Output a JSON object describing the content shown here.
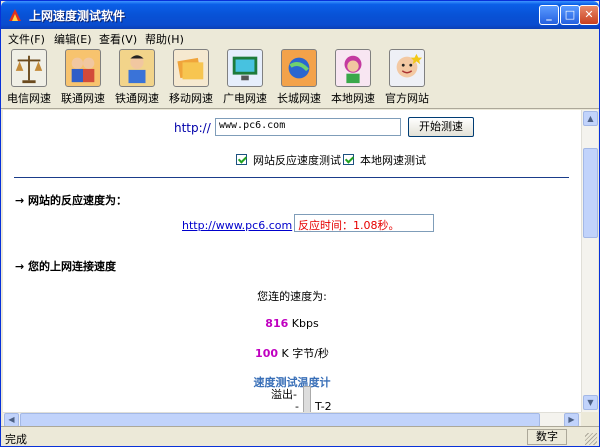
{
  "window": {
    "title": "上网速度测试软件"
  },
  "menu": [
    {
      "label": "文件(F)"
    },
    {
      "label": "编辑(E)"
    },
    {
      "label": "查看(V)"
    },
    {
      "label": "帮助(H)"
    }
  ],
  "toolbar": [
    {
      "label": "电信网速",
      "icon": "scale-icon"
    },
    {
      "label": "联通网速",
      "icon": "people-icon"
    },
    {
      "label": "铁通网速",
      "icon": "person-icon"
    },
    {
      "label": "移动网速",
      "icon": "folders-icon"
    },
    {
      "label": "广电网速",
      "icon": "monitor-icon"
    },
    {
      "label": "长城网速",
      "icon": "globe-icon"
    },
    {
      "label": "本地网速",
      "icon": "girl-icon"
    },
    {
      "label": "官方网站",
      "icon": "face-icon"
    }
  ],
  "test": {
    "http_prefix": "http://",
    "url_value": "www.pc6.com",
    "start_button": "开始测速",
    "opt_site_response": "网站反应速度测试",
    "opt_local_speed": "本地网速测试"
  },
  "site_response": {
    "heading": "→ 网站的反应速度为：",
    "link": "http://www.pc6.com",
    "response_time": "反应时间：1.08秒。"
  },
  "connection": {
    "heading": "→ 您的上网连接速度",
    "speed_label": "您连的速度为:",
    "kbps_value": "816",
    "kbps_unit": "Kbps",
    "kbytes_value": "100",
    "kbytes_unit": "K 字节/秒",
    "meter_title": "速度测试温度计",
    "meter_overflow": "溢出-",
    "meter_t2": "T-2"
  },
  "status": {
    "text": "完成",
    "panel": "数字"
  },
  "colors": {
    "titlebar": "#0852d6",
    "response_text": "#e60000",
    "speed_value": "#c000c0",
    "link": "#0000cc"
  }
}
